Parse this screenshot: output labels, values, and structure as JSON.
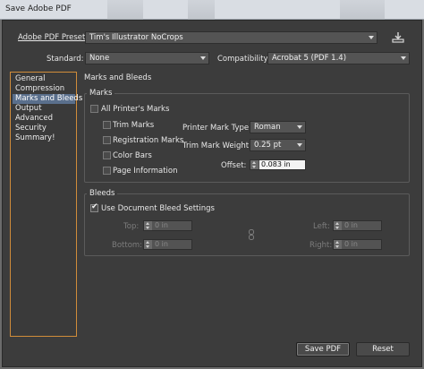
{
  "window": {
    "title": "Save Adobe PDF"
  },
  "preset": {
    "label": "Adobe PDF Preset:",
    "value": "Tim's Illustrator NoCrops"
  },
  "standard": {
    "label": "Standard:",
    "value": "None"
  },
  "compatibility": {
    "label": "Compatibility:",
    "value": "Acrobat 5 (PDF 1.4)"
  },
  "sidebar": {
    "items": [
      {
        "label": "General"
      },
      {
        "label": "Compression"
      },
      {
        "label": "Marks and Bleeds"
      },
      {
        "label": "Output"
      },
      {
        "label": "Advanced"
      },
      {
        "label": "Security"
      },
      {
        "label": "Summary!"
      }
    ]
  },
  "section_title": "Marks and Bleeds",
  "marks": {
    "group_label": "Marks",
    "all_printers_marks": {
      "label": "All Printer's Marks",
      "checked": false
    },
    "trim_marks": {
      "label": "Trim Marks",
      "checked": false
    },
    "registration_marks": {
      "label": "Registration Marks",
      "checked": false
    },
    "color_bars": {
      "label": "Color Bars",
      "checked": false
    },
    "page_information": {
      "label": "Page Information",
      "checked": false
    },
    "printer_mark_type": {
      "label": "Printer Mark Type:",
      "value": "Roman"
    },
    "trim_mark_weight": {
      "label": "Trim Mark Weight:",
      "value": "0.25 pt"
    },
    "offset": {
      "label": "Offset:",
      "value": "0.083 in"
    }
  },
  "bleeds": {
    "group_label": "Bleeds",
    "use_document": {
      "label": "Use Document Bleed Settings",
      "checked": true
    },
    "top": {
      "label": "Top:",
      "value": "0 in"
    },
    "bottom": {
      "label": "Bottom:",
      "value": "0 in"
    },
    "left": {
      "label": "Left:",
      "value": "0 in"
    },
    "right": {
      "label": "Right:",
      "value": "0 in"
    }
  },
  "footer": {
    "save_label": "Save PDF",
    "reset_label": "Reset"
  },
  "colors": {
    "dialog_bg": "#3c3c3c",
    "selection": "#5a6f8c",
    "list_border": "#d08c3a"
  },
  "icons": {
    "preset_save": "save-preset-icon",
    "link": "link-chain-icon"
  }
}
